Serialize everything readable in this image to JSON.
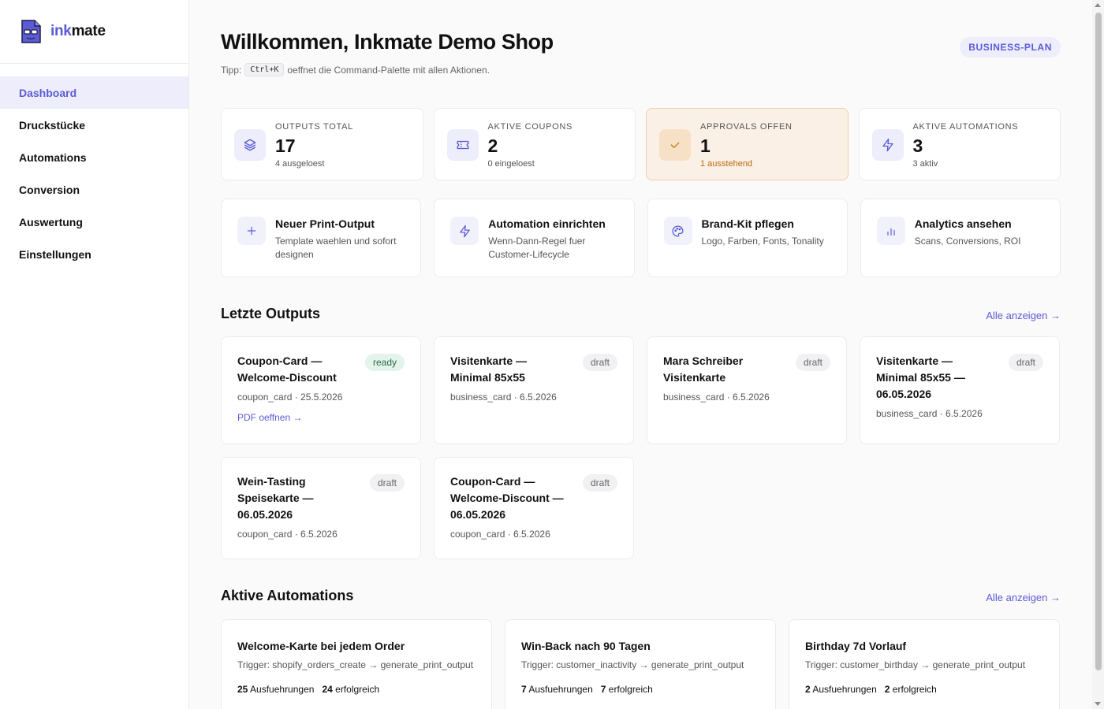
{
  "brand": {
    "name_prefix": "ink",
    "name_suffix": "mate"
  },
  "nav": [
    {
      "label": "Dashboard",
      "active": true
    },
    {
      "label": "Druckstücke",
      "active": false
    },
    {
      "label": "Automations",
      "active": false
    },
    {
      "label": "Conversion",
      "active": false
    },
    {
      "label": "Auswertung",
      "active": false
    },
    {
      "label": "Einstellungen",
      "active": false
    }
  ],
  "header": {
    "title": "Willkommen, Inkmate Demo Shop",
    "tip_prefix": "Tipp:",
    "tip_kbd": "Ctrl+K",
    "tip_suffix": "oeffnet die Command-Palette mit allen Aktionen.",
    "plan_badge": "BUSINESS-PLAN"
  },
  "stats": [
    {
      "label": "OUTPUTS TOTAL",
      "value": "17",
      "sub": "4 ausgeloest",
      "icon": "layers-icon"
    },
    {
      "label": "AKTIVE COUPONS",
      "value": "2",
      "sub": "0 eingeloest",
      "icon": "ticket-icon"
    },
    {
      "label": "APPROVALS OFFEN",
      "value": "1",
      "sub": "1 ausstehend",
      "icon": "check-icon"
    },
    {
      "label": "AKTIVE AUTOMATIONS",
      "value": "3",
      "sub": "3 aktiv",
      "icon": "zap-icon"
    }
  ],
  "actions": [
    {
      "title": "Neuer Print-Output",
      "desc": "Template waehlen und sofort designen",
      "icon": "plus-icon"
    },
    {
      "title": "Automation einrichten",
      "desc": "Wenn-Dann-Regel fuer Customer-Lifecycle",
      "icon": "zap-icon"
    },
    {
      "title": "Brand-Kit pflegen",
      "desc": "Logo, Farben, Fonts, Tonality",
      "icon": "palette-icon"
    },
    {
      "title": "Analytics ansehen",
      "desc": "Scans, Conversions, ROI",
      "icon": "bar-chart-icon"
    }
  ],
  "outputs_section": {
    "title": "Letzte Outputs",
    "see_all": "Alle anzeigen →"
  },
  "outputs": [
    {
      "title": "Coupon-Card — Welcome-Discount",
      "status": "ready",
      "meta": "coupon_card · 25.5.2026",
      "link": "PDF oeffnen →"
    },
    {
      "title": "Visitenkarte — Minimal 85x55",
      "status": "draft",
      "meta": "business_card · 6.5.2026"
    },
    {
      "title": "Mara Schreiber Visitenkarte",
      "status": "draft",
      "meta": "business_card · 6.5.2026"
    },
    {
      "title": "Visitenkarte — Minimal 85x55 — 06.05.2026",
      "status": "draft",
      "meta": "business_card · 6.5.2026"
    },
    {
      "title": "Wein-Tasting Speisekarte — 06.05.2026",
      "status": "draft",
      "meta": "coupon_card · 6.5.2026"
    },
    {
      "title": "Coupon-Card — Welcome-Discount — 06.05.2026",
      "status": "draft",
      "meta": "coupon_card · 6.5.2026"
    }
  ],
  "automations_section": {
    "title": "Aktive Automations",
    "see_all": "Alle anzeigen →"
  },
  "automations": [
    {
      "title": "Welcome-Karte bei jedem Order",
      "trigger": "Trigger: shopify_orders_create → generate_print_output",
      "runs": "25",
      "runs_label": "Ausfuehrungen",
      "success": "24",
      "success_label": "erfolgreich"
    },
    {
      "title": "Win-Back nach 90 Tagen",
      "trigger": "Trigger: customer_inactivity → generate_print_output",
      "runs": "7",
      "runs_label": "Ausfuehrungen",
      "success": "7",
      "success_label": "erfolgreich"
    },
    {
      "title": "Birthday 7d Vorlauf",
      "trigger": "Trigger: customer_birthday → generate_print_output",
      "runs": "2",
      "runs_label": "Ausfuehrungen",
      "success": "2",
      "success_label": "erfolgreich"
    }
  ],
  "colors": {
    "accent": "#5b5bd6",
    "warn_bg": "#fbf0e6",
    "warn_text": "#b96b12",
    "ready_bg": "#e4f4ec"
  }
}
